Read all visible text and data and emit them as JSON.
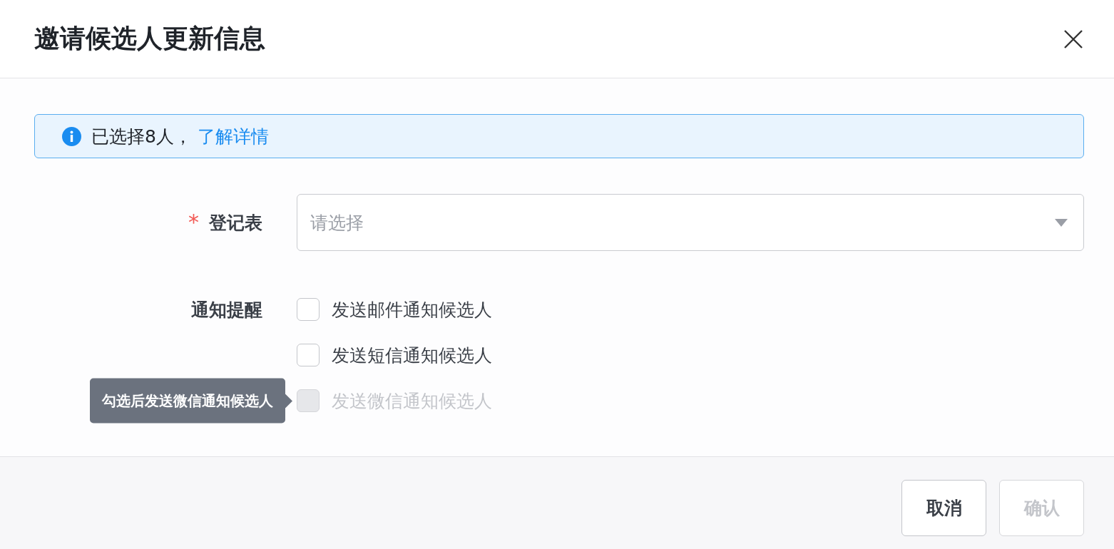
{
  "dialog": {
    "title": "邀请候选人更新信息"
  },
  "alert": {
    "text": "已选择8人，",
    "link": "了解详情"
  },
  "form": [
    {
      "kind": "select",
      "required_mark": "*",
      "label": "登记表",
      "placeholder": "请选择"
    },
    {
      "kind": "checkboxes",
      "label": "通知提醒",
      "options": [
        {
          "label": "发送邮件通知候选人",
          "checked": false,
          "disabled": false
        },
        {
          "label": "发送短信通知候选人",
          "checked": false,
          "disabled": false
        },
        {
          "label": "发送微信通知候选人",
          "checked": false,
          "disabled": true,
          "tooltip": "勾选后发送微信通知候选人"
        }
      ]
    }
  ],
  "buttons": [
    {
      "label": "取消",
      "disabled": false
    },
    {
      "label": "确认",
      "disabled": true
    }
  ]
}
